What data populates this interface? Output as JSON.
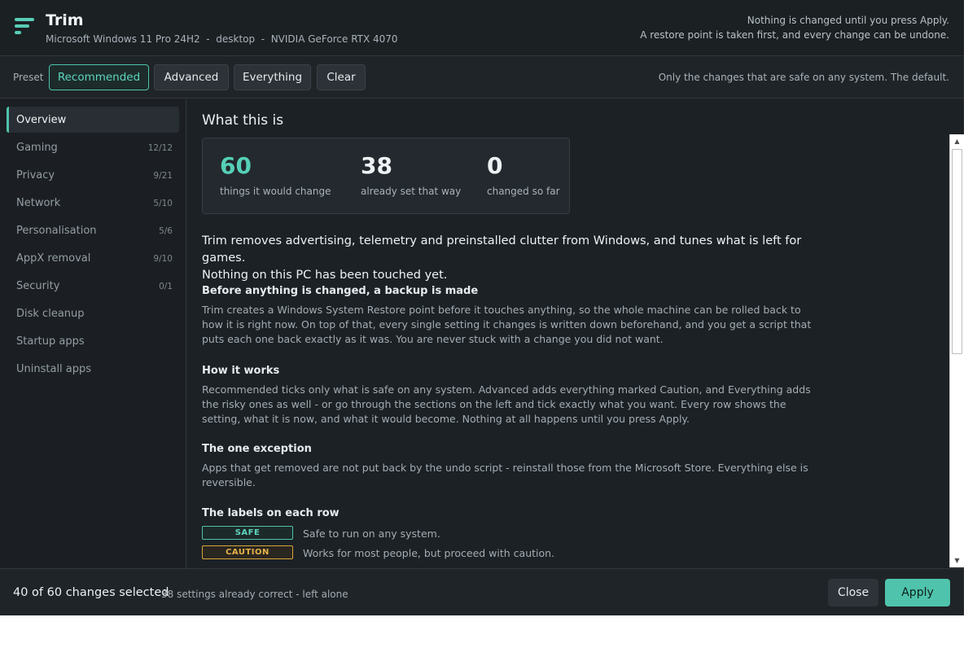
{
  "header": {
    "title": "Trim",
    "system_info": "Microsoft Windows 11 Pro 24H2  -  desktop  -  NVIDIA GeForce RTX 4070",
    "notice_line1": "Nothing is changed until you press Apply.",
    "notice_line2": "A restore point is taken first, and every change can be undone."
  },
  "presets": {
    "label": "Preset",
    "buttons": [
      {
        "label": "Recommended"
      },
      {
        "label": "Advanced"
      },
      {
        "label": "Everything"
      },
      {
        "label": "Clear"
      }
    ],
    "description": "Only the changes that are safe on any system. The default."
  },
  "sidebar": {
    "items": [
      {
        "label": "Overview",
        "count": ""
      },
      {
        "label": "Gaming",
        "count": "12/12"
      },
      {
        "label": "Privacy",
        "count": "9/21"
      },
      {
        "label": "Network",
        "count": "5/10"
      },
      {
        "label": "Personalisation",
        "count": "5/6"
      },
      {
        "label": "AppX removal",
        "count": "9/10"
      },
      {
        "label": "Security",
        "count": "0/1"
      },
      {
        "label": "Disk cleanup",
        "count": ""
      },
      {
        "label": "Startup apps",
        "count": ""
      },
      {
        "label": "Uninstall apps",
        "count": ""
      }
    ]
  },
  "main": {
    "heading": "What this is",
    "stats": [
      {
        "value": "60",
        "label": "things it would change"
      },
      {
        "value": "38",
        "label": "already set that way"
      },
      {
        "value": "0",
        "label": "changed so far"
      }
    ],
    "lead_line1": "Trim removes advertising, telemetry and preinstalled clutter from Windows, and tunes what is left for games.",
    "lead_line2": "Nothing on this PC has been touched yet.",
    "sections": [
      {
        "heading": "Before anything is changed, a backup is made",
        "body": "Trim creates a Windows System Restore point before it touches anything, so the whole machine can be rolled back to how it is right now. On top of that, every single setting it changes is written down beforehand, and you get a script that puts each one back exactly as it was. You are never stuck with a change you did not want."
      },
      {
        "heading": "How it works",
        "body": "Recommended ticks only what is safe on any system. Advanced adds everything marked Caution, and Everything adds the risky ones as well - or go through the sections on the left and tick exactly what you want. Every row shows the setting, what it is now, and what it would become. Nothing at all happens until you press Apply."
      },
      {
        "heading": "The one exception",
        "body": "Apps that get removed are not put back by the undo script - reinstall those from the Microsoft Store. Everything else is reversible."
      },
      {
        "heading": "The labels on each row",
        "body": ""
      }
    ],
    "labels": [
      {
        "tag": "SAFE",
        "description": "Safe to run on any system."
      },
      {
        "tag": "CAUTION",
        "description": "Works for most people, but proceed with caution."
      }
    ]
  },
  "footer": {
    "selected": "40 of 60 changes selected",
    "note": "38 settings already correct - left alone",
    "close_label": "Close",
    "apply_label": "Apply"
  },
  "colors": {
    "accent": "#4fc3ac",
    "caution": "#d9a63a",
    "background": "#1c2125"
  },
  "icons": {
    "app_logo": "menu-lines-icon",
    "scroll_up": "triangle-up-icon",
    "scroll_down": "triangle-down-icon"
  }
}
